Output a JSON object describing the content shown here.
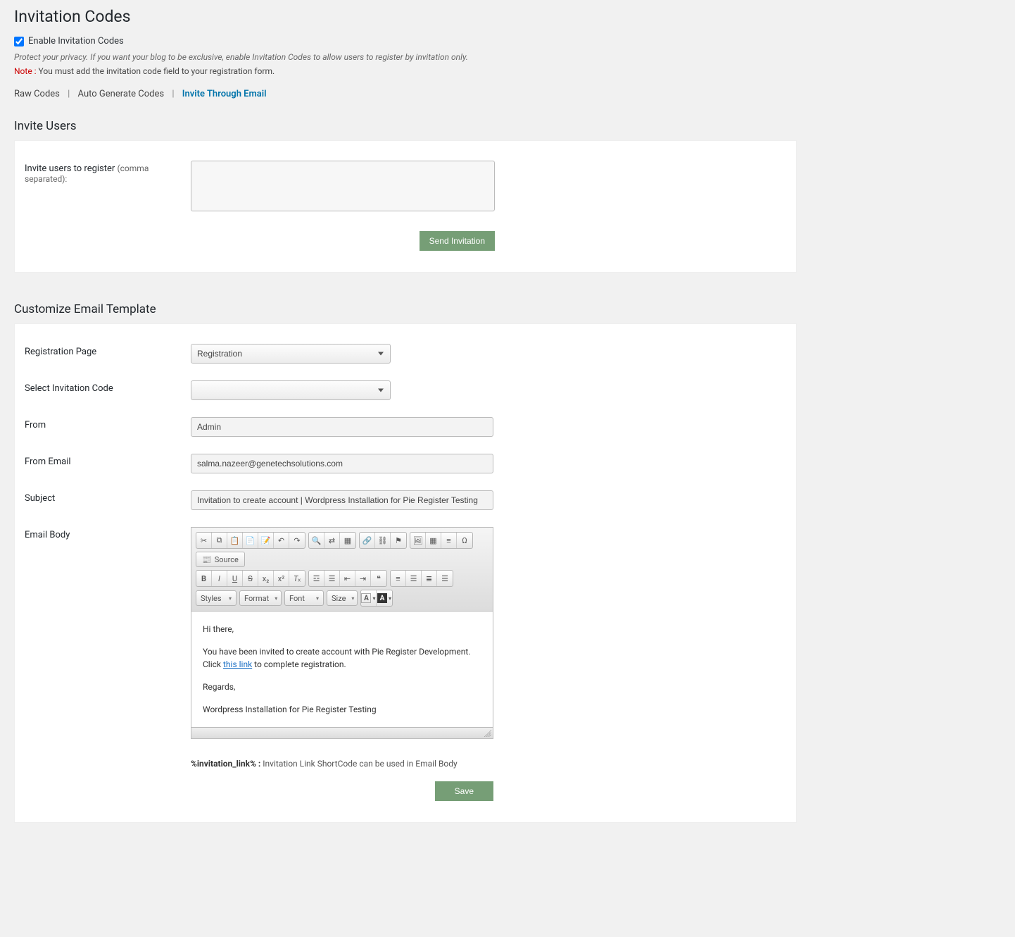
{
  "page": {
    "title": "Invitation Codes",
    "enable_label": "Enable Invitation Codes",
    "privacy_note": "Protect your privacy. If you want your blog to be exclusive, enable Invitation Codes to allow users to register by invitation only.",
    "note_prefix": "Note :",
    "note_text": " You must add the invitation code field to your registration form."
  },
  "tabs": {
    "raw": "Raw Codes",
    "auto": "Auto Generate Codes",
    "invite": "Invite Through Email"
  },
  "invite_section": {
    "heading": "Invite Users",
    "label_main": "Invite users to register ",
    "label_sub": "(comma separated):",
    "textarea_value": "",
    "send_button": "Send Invitation"
  },
  "template_section": {
    "heading": "Customize Email Template",
    "reg_page_label": "Registration Page",
    "reg_page_value": "Registration",
    "code_label": "Select Invitation Code",
    "code_value": "",
    "from_label": "From",
    "from_value": "Admin",
    "from_email_label": "From Email",
    "from_email_value": "salma.nazeer@genetechsolutions.com",
    "subject_label": "Subject",
    "subject_value": "Invitation to create account | Wordpress Installation for Pie Register Testing",
    "body_label": "Email Body",
    "editor": {
      "source": "Source",
      "styles": "Styles",
      "format": "Format",
      "font": "Font",
      "size": "Size"
    },
    "body": {
      "greeting": "Hi there,",
      "line1a": "You have been invited to create account with Pie Register Development. Click ",
      "link": "this link",
      "line1b": " to complete registration.",
      "regards": "Regards,",
      "sig": "Wordpress Installation for Pie Register Testing"
    },
    "shortcode_bold": "%invitation_link% :",
    "shortcode_text": " Invitation Link ShortCode can be used in Email Body",
    "save_button": "Save"
  }
}
